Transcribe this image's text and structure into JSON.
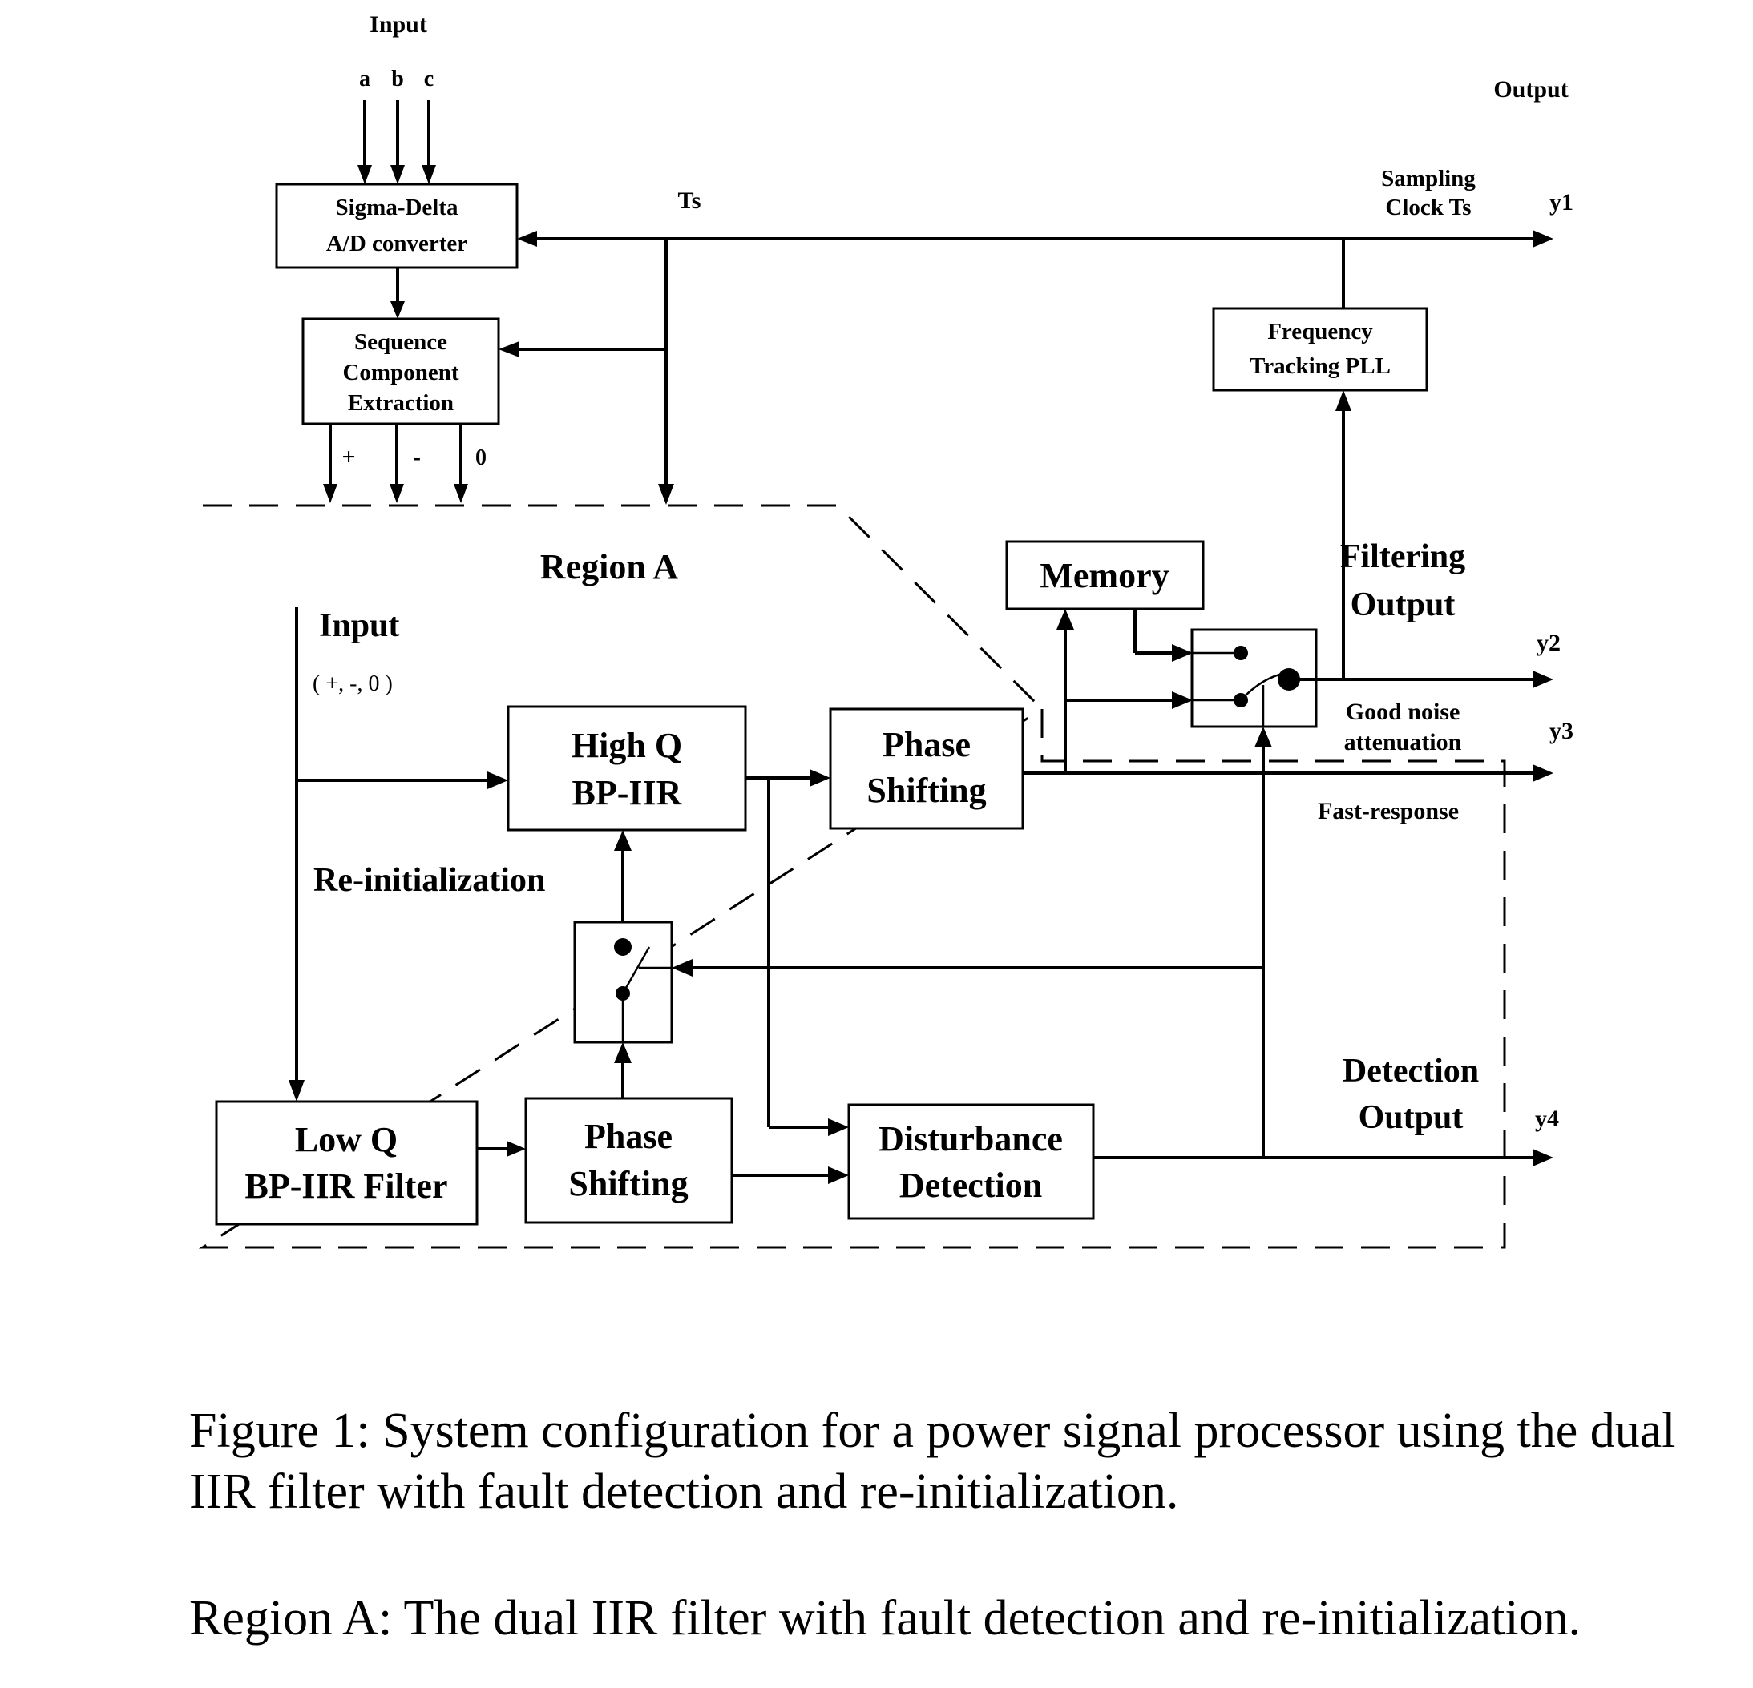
{
  "diagram": {
    "top_input_label": "Input",
    "phase_labels": [
      "a",
      "b",
      "c"
    ],
    "output_header": "Output",
    "ts_label": "Ts",
    "sampling_clock_label": [
      "Sampling",
      "Clock Ts"
    ],
    "region_label": "Region A",
    "inner_input_label": "Input",
    "inner_input_sub": "( +, -, 0 )",
    "reinit_label": "Re-initialization",
    "sequence_outputs": [
      "+",
      "-",
      "0"
    ],
    "filtering_output_label": [
      "Filtering",
      "Output"
    ],
    "good_noise_label": [
      "Good noise",
      "attenuation"
    ],
    "fast_response_label": "Fast-response",
    "detection_output_label": [
      "Detection",
      "Output"
    ],
    "outputs": [
      "y1",
      "y2",
      "y3",
      "y4"
    ],
    "blocks": {
      "sigma_delta": [
        "Sigma-Delta",
        "A/D converter"
      ],
      "sequence": [
        "Sequence",
        "Component",
        "Extraction"
      ],
      "freq_pll": [
        "Frequency",
        "Tracking PLL"
      ],
      "memory": [
        "Memory"
      ],
      "high_q": [
        "High Q",
        "BP-IIR"
      ],
      "phase_shift_1": [
        "Phase",
        "Shifting"
      ],
      "low_q": [
        "Low Q",
        "BP-IIR Filter"
      ],
      "phase_shift_2": [
        "Phase",
        "Shifting"
      ],
      "disturbance": [
        "Disturbance",
        "Detection"
      ]
    }
  },
  "caption": {
    "figure": "Figure 1:  System configuration for a power signal processor using the dual IIR filter with fault detection and re-initialization.",
    "region": "Region A: The dual IIR filter with fault detection and re-initialization."
  }
}
